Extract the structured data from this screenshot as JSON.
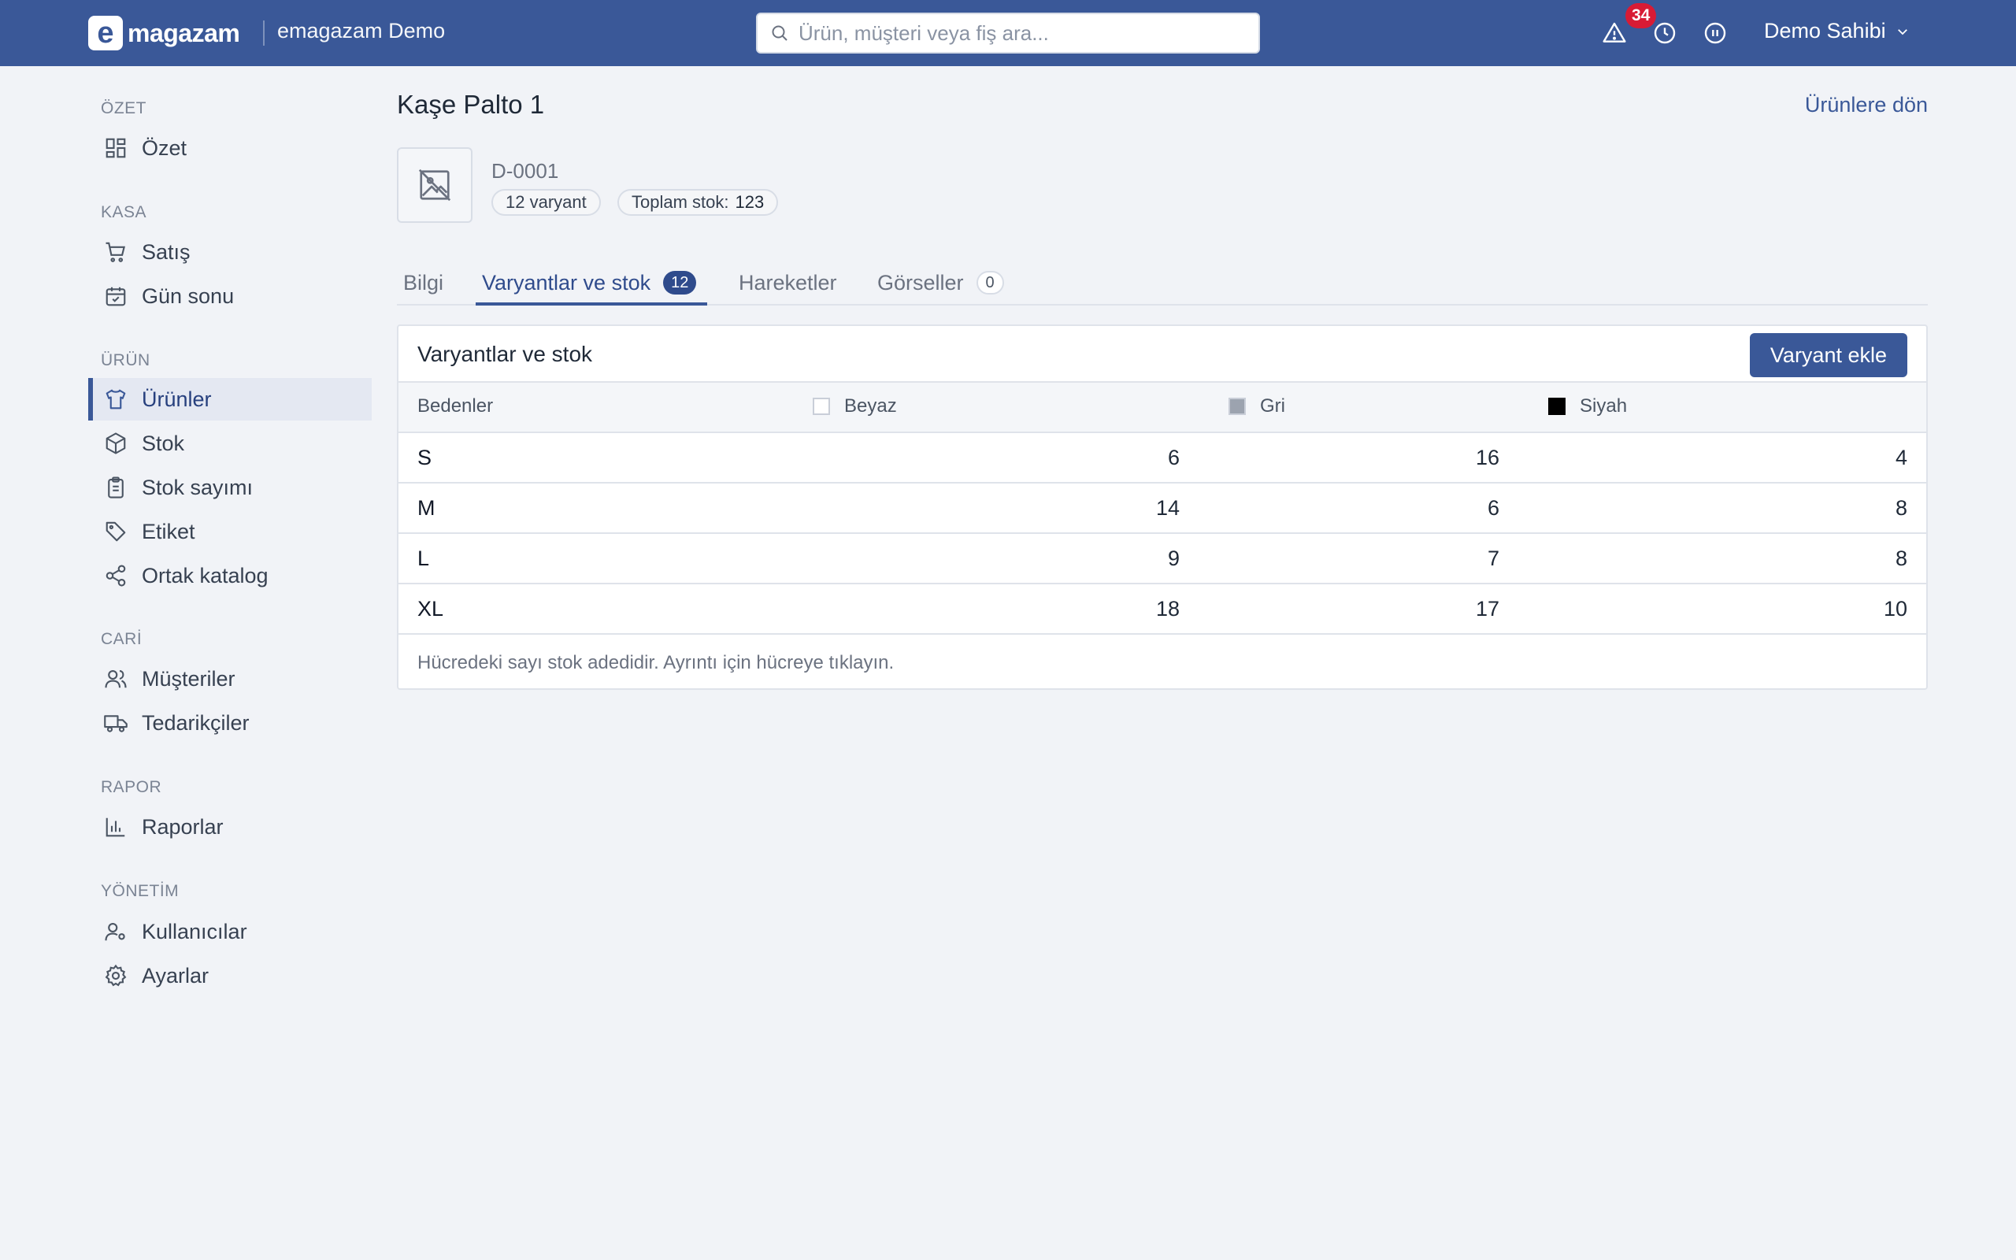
{
  "app": {
    "logo_letter": "e",
    "logo_text": "magazam",
    "store_name": "emagazam Demo",
    "search_placeholder": "Ürün, müşteri veya fiş ara...",
    "notification_count": "34",
    "user_name": "Demo Sahibi",
    "accent_color": "#3a5898"
  },
  "sidebar": {
    "sections": [
      {
        "title": "ÖZET",
        "items": [
          {
            "label": "Özet",
            "icon": "dashboard-icon"
          }
        ]
      },
      {
        "title": "KASA",
        "items": [
          {
            "label": "Satış",
            "icon": "cart-icon"
          },
          {
            "label": "Gün sonu",
            "icon": "calendar-icon"
          }
        ]
      },
      {
        "title": "ÜRÜN",
        "items": [
          {
            "label": "Ürünler",
            "icon": "shirt-icon",
            "active": true
          },
          {
            "label": "Stok",
            "icon": "box-icon"
          },
          {
            "label": "Stok sayımı",
            "icon": "clipboard-icon"
          },
          {
            "label": "Etiket",
            "icon": "tag-icon"
          },
          {
            "label": "Ortak katalog",
            "icon": "share-icon"
          }
        ]
      },
      {
        "title": "CARİ",
        "items": [
          {
            "label": "Müşteriler",
            "icon": "users-icon"
          },
          {
            "label": "Tedarikçiler",
            "icon": "truck-icon"
          }
        ]
      },
      {
        "title": "RAPOR",
        "items": [
          {
            "label": "Raporlar",
            "icon": "bar-chart-icon"
          }
        ]
      },
      {
        "title": "YÖNETİM",
        "items": [
          {
            "label": "Kullanıcılar",
            "icon": "user-settings-icon"
          },
          {
            "label": "Ayarlar",
            "icon": "gear-icon"
          }
        ]
      }
    ]
  },
  "product": {
    "title": "Kaşe Palto 1",
    "back_link": "Ürünlere dön",
    "sku": "D-0001",
    "variant_pill": "12 varyant",
    "stock_label": "Toplam stok:",
    "stock_value": "123"
  },
  "tabs": [
    {
      "label": "Bilgi"
    },
    {
      "label": "Varyantlar ve stok",
      "count": "12",
      "active": true
    },
    {
      "label": "Hareketler"
    },
    {
      "label": "Görseller",
      "count": "0"
    }
  ],
  "variants": {
    "card_title": "Varyantlar ve stok",
    "add_button": "Varyant ekle",
    "size_header": "Bedenler",
    "colors": [
      {
        "name": "Beyaz",
        "swatch": "#ffffff"
      },
      {
        "name": "Gri",
        "swatch": "#9ca3af"
      },
      {
        "name": "Siyah",
        "swatch": "#000000"
      }
    ],
    "rows": [
      {
        "size": "S",
        "values": [
          "6",
          "16",
          "4"
        ]
      },
      {
        "size": "M",
        "values": [
          "14",
          "6",
          "8"
        ]
      },
      {
        "size": "L",
        "values": [
          "9",
          "7",
          "8"
        ]
      },
      {
        "size": "XL",
        "values": [
          "18",
          "17",
          "10"
        ]
      }
    ],
    "footnote": "Hücredeki sayı stok adedidir. Ayrıntı için hücreye tıklayın."
  }
}
